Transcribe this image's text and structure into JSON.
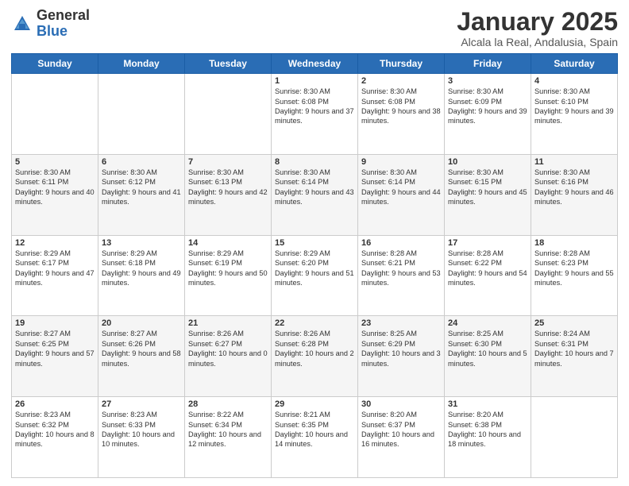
{
  "header": {
    "logo_general": "General",
    "logo_blue": "Blue",
    "month_title": "January 2025",
    "location": "Alcala la Real, Andalusia, Spain"
  },
  "days_of_week": [
    "Sunday",
    "Monday",
    "Tuesday",
    "Wednesday",
    "Thursday",
    "Friday",
    "Saturday"
  ],
  "weeks": [
    [
      {
        "day": "",
        "text": ""
      },
      {
        "day": "",
        "text": ""
      },
      {
        "day": "",
        "text": ""
      },
      {
        "day": "1",
        "text": "Sunrise: 8:30 AM\nSunset: 6:08 PM\nDaylight: 9 hours\nand 37 minutes."
      },
      {
        "day": "2",
        "text": "Sunrise: 8:30 AM\nSunset: 6:08 PM\nDaylight: 9 hours\nand 38 minutes."
      },
      {
        "day": "3",
        "text": "Sunrise: 8:30 AM\nSunset: 6:09 PM\nDaylight: 9 hours\nand 39 minutes."
      },
      {
        "day": "4",
        "text": "Sunrise: 8:30 AM\nSunset: 6:10 PM\nDaylight: 9 hours\nand 39 minutes."
      }
    ],
    [
      {
        "day": "5",
        "text": "Sunrise: 8:30 AM\nSunset: 6:11 PM\nDaylight: 9 hours\nand 40 minutes."
      },
      {
        "day": "6",
        "text": "Sunrise: 8:30 AM\nSunset: 6:12 PM\nDaylight: 9 hours\nand 41 minutes."
      },
      {
        "day": "7",
        "text": "Sunrise: 8:30 AM\nSunset: 6:13 PM\nDaylight: 9 hours\nand 42 minutes."
      },
      {
        "day": "8",
        "text": "Sunrise: 8:30 AM\nSunset: 6:14 PM\nDaylight: 9 hours\nand 43 minutes."
      },
      {
        "day": "9",
        "text": "Sunrise: 8:30 AM\nSunset: 6:14 PM\nDaylight: 9 hours\nand 44 minutes."
      },
      {
        "day": "10",
        "text": "Sunrise: 8:30 AM\nSunset: 6:15 PM\nDaylight: 9 hours\nand 45 minutes."
      },
      {
        "day": "11",
        "text": "Sunrise: 8:30 AM\nSunset: 6:16 PM\nDaylight: 9 hours\nand 46 minutes."
      }
    ],
    [
      {
        "day": "12",
        "text": "Sunrise: 8:29 AM\nSunset: 6:17 PM\nDaylight: 9 hours\nand 47 minutes."
      },
      {
        "day": "13",
        "text": "Sunrise: 8:29 AM\nSunset: 6:18 PM\nDaylight: 9 hours\nand 49 minutes."
      },
      {
        "day": "14",
        "text": "Sunrise: 8:29 AM\nSunset: 6:19 PM\nDaylight: 9 hours\nand 50 minutes."
      },
      {
        "day": "15",
        "text": "Sunrise: 8:29 AM\nSunset: 6:20 PM\nDaylight: 9 hours\nand 51 minutes."
      },
      {
        "day": "16",
        "text": "Sunrise: 8:28 AM\nSunset: 6:21 PM\nDaylight: 9 hours\nand 53 minutes."
      },
      {
        "day": "17",
        "text": "Sunrise: 8:28 AM\nSunset: 6:22 PM\nDaylight: 9 hours\nand 54 minutes."
      },
      {
        "day": "18",
        "text": "Sunrise: 8:28 AM\nSunset: 6:23 PM\nDaylight: 9 hours\nand 55 minutes."
      }
    ],
    [
      {
        "day": "19",
        "text": "Sunrise: 8:27 AM\nSunset: 6:25 PM\nDaylight: 9 hours\nand 57 minutes."
      },
      {
        "day": "20",
        "text": "Sunrise: 8:27 AM\nSunset: 6:26 PM\nDaylight: 9 hours\nand 58 minutes."
      },
      {
        "day": "21",
        "text": "Sunrise: 8:26 AM\nSunset: 6:27 PM\nDaylight: 10 hours\nand 0 minutes."
      },
      {
        "day": "22",
        "text": "Sunrise: 8:26 AM\nSunset: 6:28 PM\nDaylight: 10 hours\nand 2 minutes."
      },
      {
        "day": "23",
        "text": "Sunrise: 8:25 AM\nSunset: 6:29 PM\nDaylight: 10 hours\nand 3 minutes."
      },
      {
        "day": "24",
        "text": "Sunrise: 8:25 AM\nSunset: 6:30 PM\nDaylight: 10 hours\nand 5 minutes."
      },
      {
        "day": "25",
        "text": "Sunrise: 8:24 AM\nSunset: 6:31 PM\nDaylight: 10 hours\nand 7 minutes."
      }
    ],
    [
      {
        "day": "26",
        "text": "Sunrise: 8:23 AM\nSunset: 6:32 PM\nDaylight: 10 hours\nand 8 minutes."
      },
      {
        "day": "27",
        "text": "Sunrise: 8:23 AM\nSunset: 6:33 PM\nDaylight: 10 hours\nand 10 minutes."
      },
      {
        "day": "28",
        "text": "Sunrise: 8:22 AM\nSunset: 6:34 PM\nDaylight: 10 hours\nand 12 minutes."
      },
      {
        "day": "29",
        "text": "Sunrise: 8:21 AM\nSunset: 6:35 PM\nDaylight: 10 hours\nand 14 minutes."
      },
      {
        "day": "30",
        "text": "Sunrise: 8:20 AM\nSunset: 6:37 PM\nDaylight: 10 hours\nand 16 minutes."
      },
      {
        "day": "31",
        "text": "Sunrise: 8:20 AM\nSunset: 6:38 PM\nDaylight: 10 hours\nand 18 minutes."
      },
      {
        "day": "",
        "text": ""
      }
    ]
  ]
}
